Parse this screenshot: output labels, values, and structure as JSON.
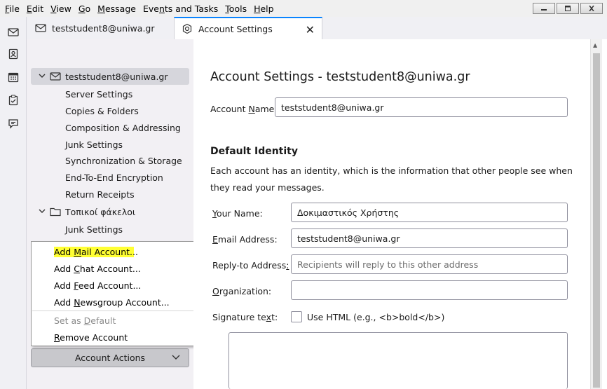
{
  "menubar": {
    "items": [
      {
        "label": "File",
        "u": "F",
        "rest": "ile"
      },
      {
        "label": "Edit",
        "u": "E",
        "rest": "dit"
      },
      {
        "label": "View",
        "u": "V",
        "rest": "iew"
      },
      {
        "label": "Go",
        "u": "G",
        "rest": "o"
      },
      {
        "label": "Message",
        "u": "M",
        "rest": "essage"
      },
      {
        "label": "Events and Tasks",
        "pre": "Eve",
        "u": "n",
        "rest": "ts and Tasks"
      },
      {
        "label": "Tools",
        "u": "T",
        "rest": "ools"
      },
      {
        "label": "Help",
        "u": "H",
        "rest": "elp"
      }
    ]
  },
  "tabs": {
    "mail_tab": "teststudent8@uniwa.gr",
    "settings_tab": "Account Settings",
    "close_glyph": "✕"
  },
  "tree": {
    "account": "teststudent8@uniwa.gr",
    "account_children": [
      "Server Settings",
      "Copies & Folders",
      "Composition & Addressing",
      "Junk Settings",
      "Synchronization & Storage",
      "End-To-End Encryption",
      "Return Receipts"
    ],
    "local_folders": "Τοπικοί φάκελοι",
    "local_children": [
      "Junk Settings"
    ]
  },
  "context_menu": {
    "add_mail": {
      "pre": "Add ",
      "u": "M",
      "rest": "ail Account..."
    },
    "add_chat": {
      "pre": "Add ",
      "u": "C",
      "rest": "hat Account..."
    },
    "add_feed": {
      "pre": "Add ",
      "u": "F",
      "rest": "eed Account..."
    },
    "add_news": {
      "pre": "Add ",
      "u": "N",
      "rest": "ewsgroup Account..."
    },
    "set_default": {
      "pre": "Set as ",
      "u": "D",
      "rest": "efault"
    },
    "remove": {
      "pre": "",
      "u": "R",
      "rest": "emove Account"
    }
  },
  "account_actions": {
    "label": "Account Actions",
    "chevron": "⌄"
  },
  "content": {
    "title": "Account Settings - teststudent8@uniwa.gr",
    "account_name_label": {
      "pre": "Account ",
      "u": "N",
      "rest": "ame:"
    },
    "account_name_value": "teststudent8@uniwa.gr",
    "section_title": "Default Identity",
    "description": "Each account has an identity, which is the information that other people see when they read your messages.",
    "your_name_label": {
      "pre": "",
      "u": "Y",
      "rest": "our Name:"
    },
    "your_name_value": "Δοκιμαστικός Χρήστης",
    "email_label": {
      "pre": "",
      "u": "E",
      "rest": "mail Address:"
    },
    "email_value": "teststudent8@uniwa.gr",
    "reply_label": {
      "pre": "Reply-to Address",
      "u": ":",
      "rest": ""
    },
    "reply_placeholder": "Recipients will reply to this other address",
    "org_label": {
      "pre": "",
      "u": "O",
      "rest": "rganization:"
    },
    "org_value": "",
    "signature_label": {
      "pre": "Signature te",
      "u": "x",
      "rest": "t:"
    },
    "use_html_label": "Use HTML (e.g., <b>bold</b>)",
    "signature_value": ""
  },
  "colors": {
    "accent": "#0a84ff",
    "highlight": "#ffff33",
    "sidebar_bg": "#f2f0f4",
    "selected_row": "#d6d6dc"
  },
  "icons": {
    "spaces": [
      "mail-icon",
      "address-book-icon",
      "calendar-icon",
      "tasks-icon",
      "chat-icon"
    ],
    "tab_mail": "mail-icon",
    "tab_settings": "gear-icon",
    "account": "mail-icon",
    "local_folders": "folder-icon"
  }
}
